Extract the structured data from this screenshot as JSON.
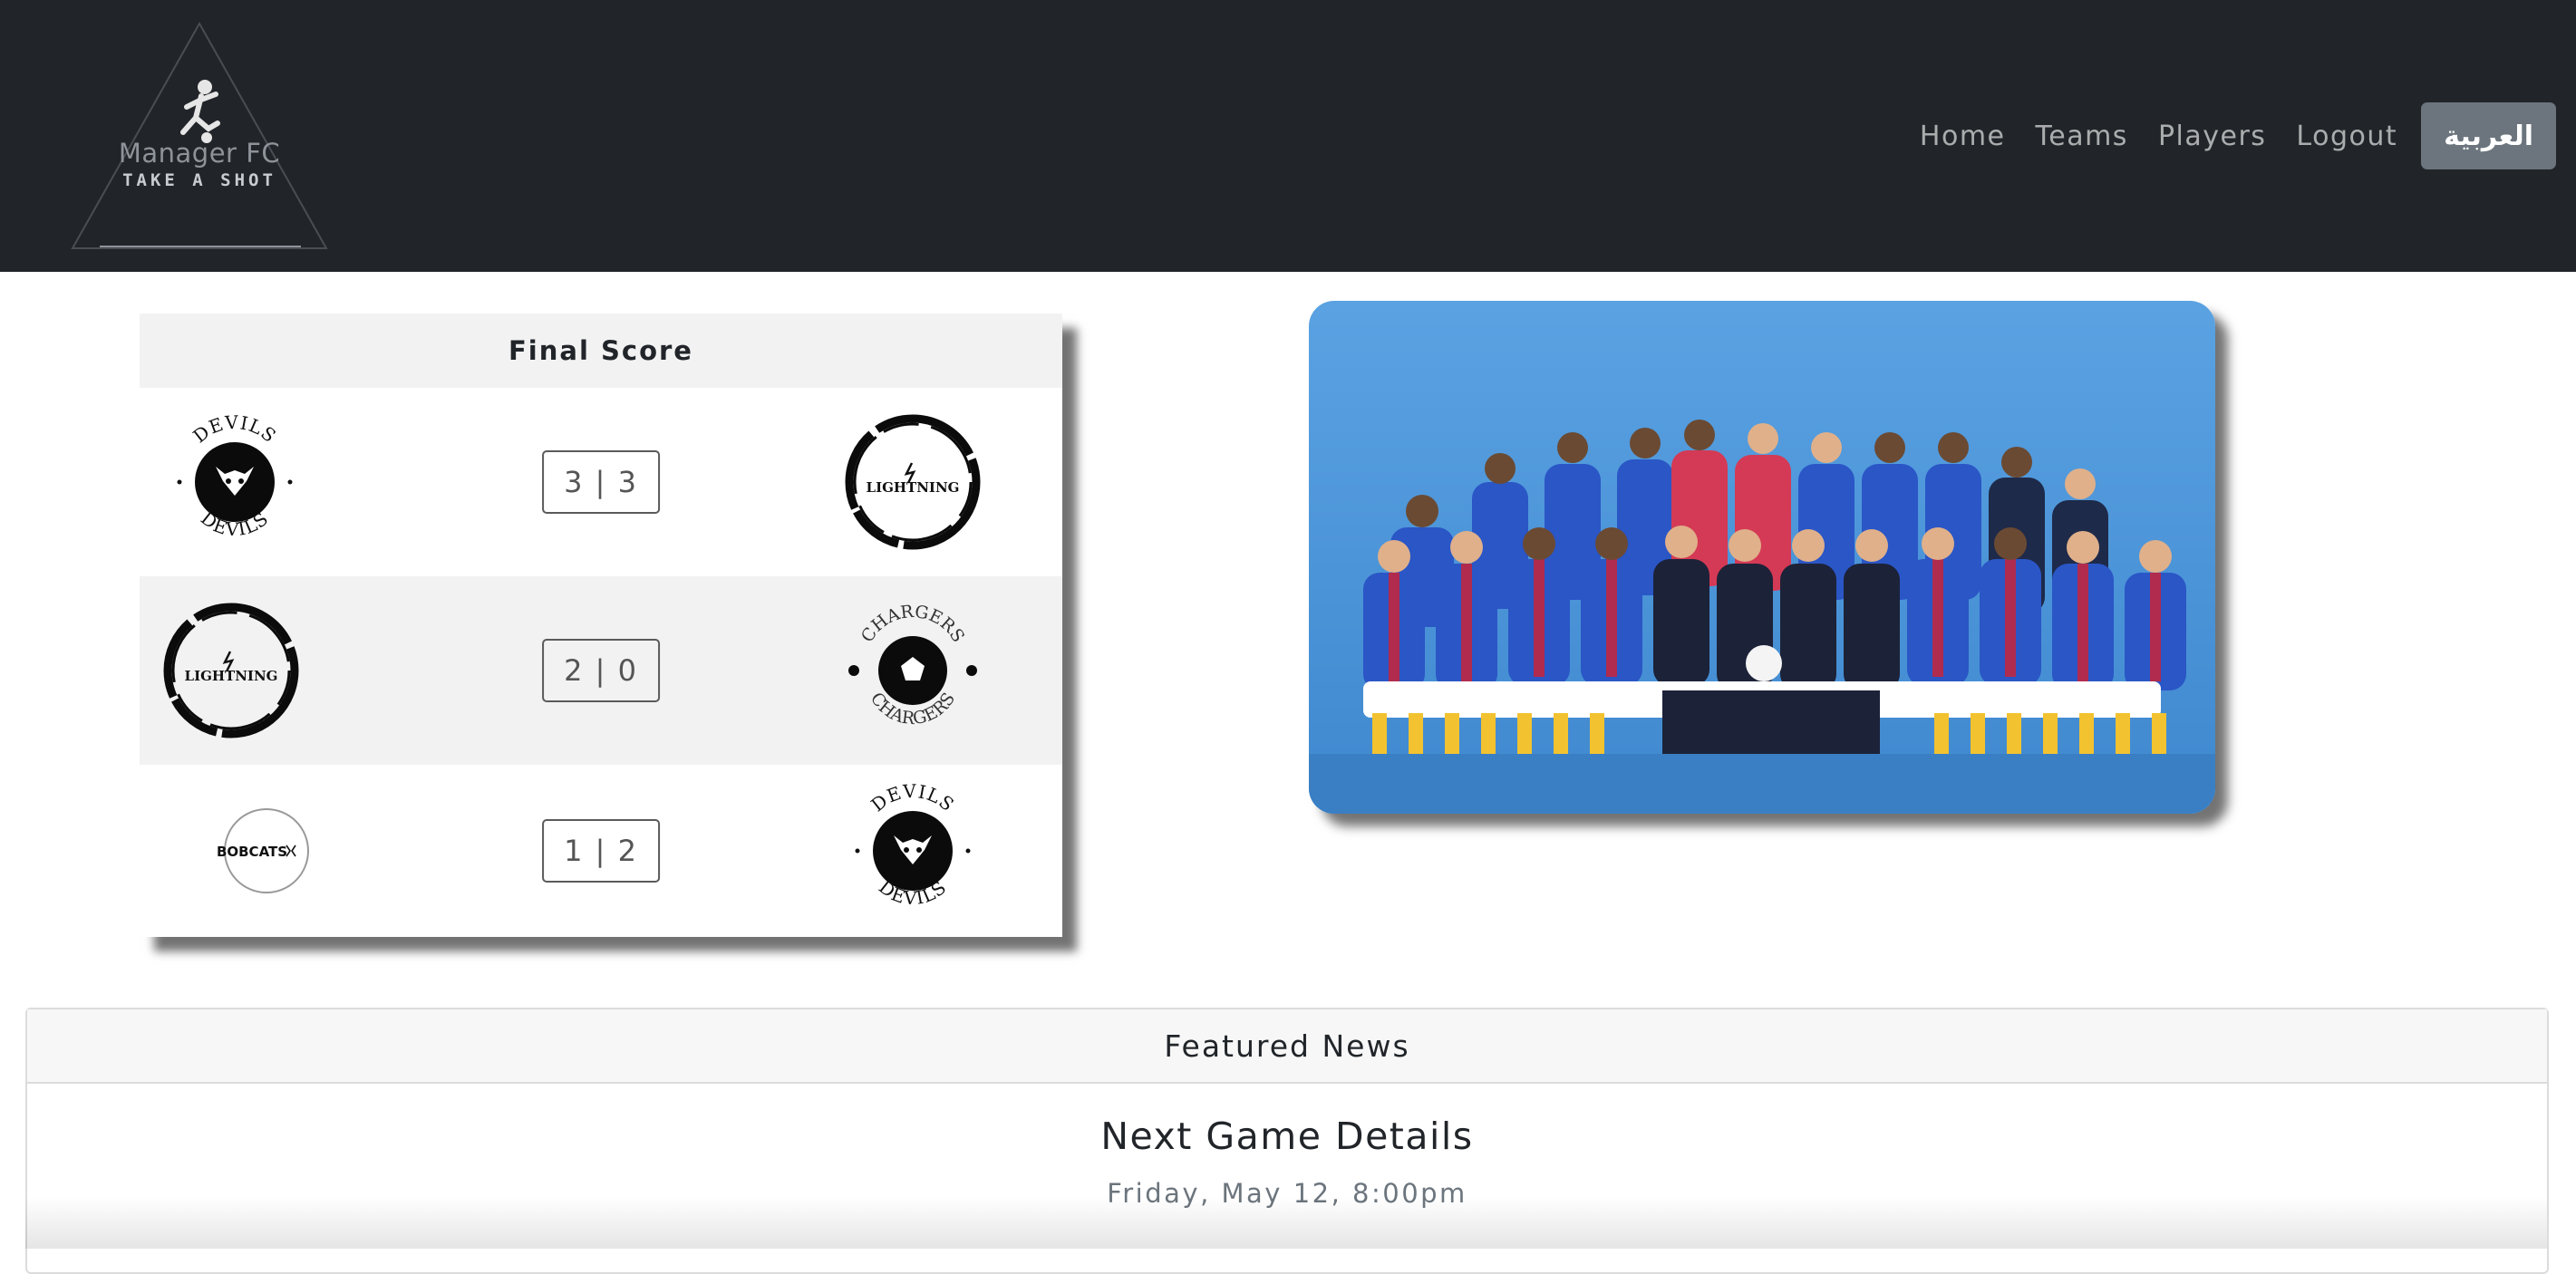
{
  "brand": {
    "name": "Manager FC",
    "tagline": "TAKE A SHOT"
  },
  "nav": {
    "home": "Home",
    "teams": "Teams",
    "players": "Players",
    "logout": "Logout",
    "language": "العربية"
  },
  "scores": {
    "heading": "Final Score",
    "matches": [
      {
        "home": "DEVILS",
        "away": "LIGHTNING",
        "score": "3 | 3"
      },
      {
        "home": "LIGHTNING",
        "away": "CHARGERS",
        "score": "2 | 0"
      },
      {
        "home": "BOBCATS",
        "away": "DEVILS",
        "score": "1 | 2"
      }
    ]
  },
  "news": {
    "heading": "Featured News",
    "title": "Next Game Details",
    "subtitle": "Friday, May 12, 8:00pm"
  },
  "colors": {
    "navbar": "#212529",
    "language_button": "#6c757d",
    "photo_background": "#4b94d6",
    "kit_blue": "#2a56c6",
    "kit_red": "#c8243a"
  }
}
